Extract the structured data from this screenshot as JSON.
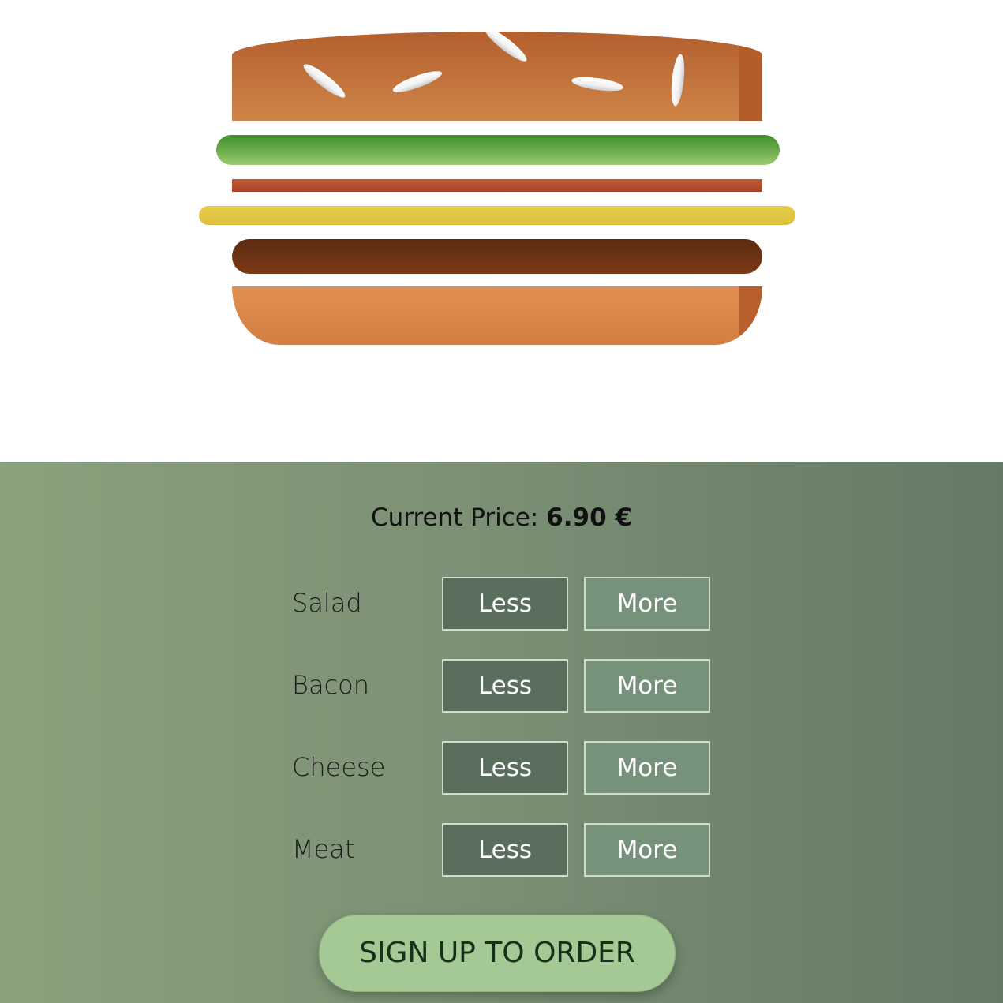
{
  "price": {
    "label": "Current Price:",
    "value": "6.90 €"
  },
  "ingredients": [
    {
      "name": "Salad",
      "less_label": "Less",
      "more_label": "More"
    },
    {
      "name": "Bacon",
      "less_label": "Less",
      "more_label": "More"
    },
    {
      "name": "Cheese",
      "less_label": "Less",
      "more_label": "More"
    },
    {
      "name": "Meat",
      "less_label": "Less",
      "more_label": "More"
    }
  ],
  "order_button": {
    "label": "SIGN UP TO ORDER"
  },
  "colors": {
    "bread": "#cf8548",
    "salad": "#6bab4c",
    "bacon": "#a8432a",
    "cheese": "#e8cd4a",
    "meat": "#6b3315",
    "controls_background": "#7c9175",
    "less_button": "#596e5c",
    "more_button": "#77927a",
    "order_button": "#a4c994"
  }
}
